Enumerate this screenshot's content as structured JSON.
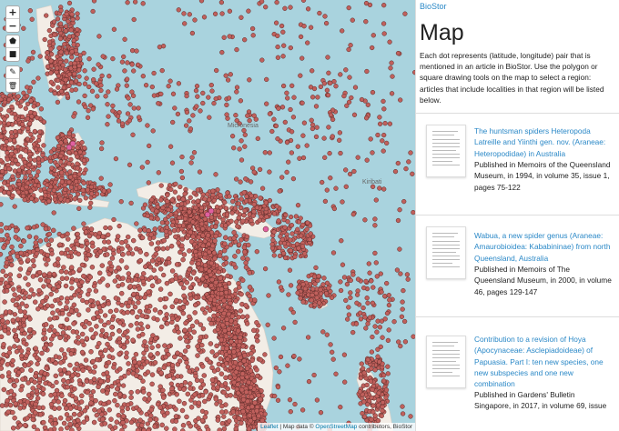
{
  "map": {
    "zoom_in": "+",
    "zoom_out": "−",
    "draw_polygon": "⬟",
    "draw_square": "■",
    "edit_layers": "✎",
    "delete_layers": "🗑",
    "labels": {
      "micronesia": "Micronesia",
      "kiribati": "Kiribati"
    },
    "attribution": {
      "leaflet": "Leaflet",
      "sep1": " | Map data © ",
      "osm": "OpenStreetMap",
      "rest": " contributors, BioStor"
    },
    "colors": {
      "sea": "#a9d3de",
      "land": "#f3ede6",
      "dot_fill": "#c0605c",
      "dot_stroke": "#5a2a28",
      "highlight": "#e060a0"
    }
  },
  "panel": {
    "brand": "BioStor",
    "title": "Map",
    "description": "Each dot represents (latitude, longitude) pair that is mentioned in an article in BioStor. Use the polygon or square drawing tools on the map to select a region: articles that include localities in that region will be listed below.",
    "articles": [
      {
        "title": "The huntsman spiders Heteropoda Latreille and Yiinthi gen. nov. (Araneae: Heteropodidae) in Australia",
        "published": "Published in Memoirs of the Queensland Museum, in 1994, in volume 35, issue 1, pages 75-122"
      },
      {
        "title": "Wabua, a new spider genus (Araneae: Amaurobioidea: Kababininae) from north Queensland, Australia",
        "published": "Published in Memoirs of The Queensland Museum, in 2000, in volume 46, pages 129-147"
      },
      {
        "title": "Contribution to a revision of Hoya (Apocynaceae: Asclepiadoideae) of Papuasia. Part I: ten new species, one new subspecies and one new combination",
        "published": "Published in Gardens' Bulletin Singapore, in 2017, in volume 69, issue"
      }
    ]
  }
}
